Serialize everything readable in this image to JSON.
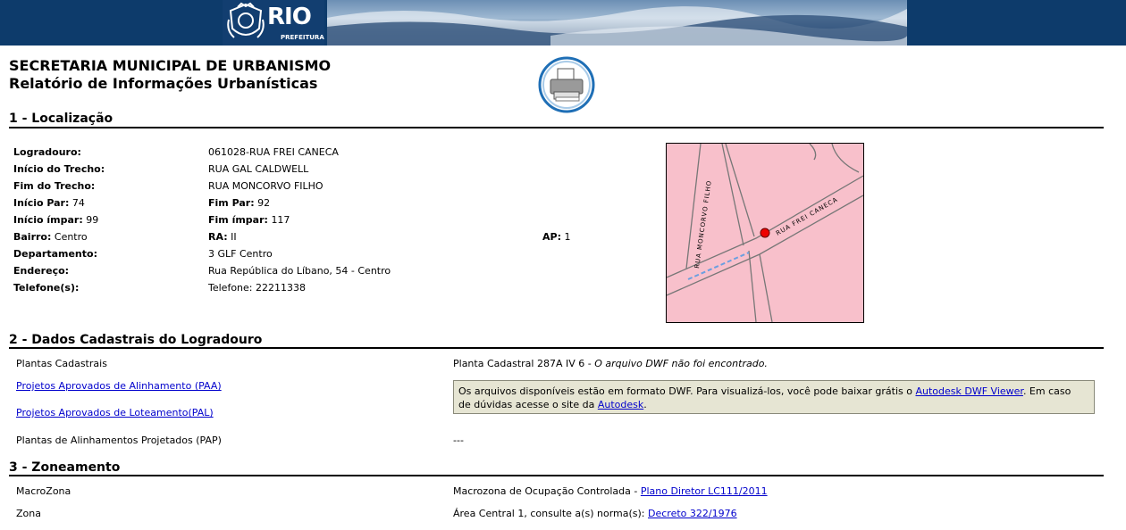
{
  "header": {
    "brand": "RIO",
    "brand_sub": "PREFEITURA"
  },
  "page": {
    "title_line1": "SECRETARIA MUNICIPAL DE URBANISMO",
    "title_line2": "Relatório de Informações Urbanísticas"
  },
  "section1": {
    "title": "1 - Localização",
    "logradouro_label": "Logradouro:",
    "logradouro": "061028-RUA FREI CANECA",
    "inicio_trecho_label": "Início do Trecho:",
    "inicio_trecho": "RUA GAL CALDWELL",
    "fim_trecho_label": "Fim do Trecho:",
    "fim_trecho": "RUA MONCORVO FILHO",
    "inicio_par_label": "Início Par:",
    "inicio_par": "74",
    "fim_par_label": "Fim Par:",
    "fim_par": "92",
    "inicio_impar_label": "Início ímpar:",
    "inicio_impar": "99",
    "fim_impar_label": "Fim ímpar:",
    "fim_impar": "117",
    "bairro_label": "Bairro:",
    "bairro": "Centro",
    "ra_label": "RA:",
    "ra": "II",
    "ap_label": "AP:",
    "ap": "1",
    "departamento_label": "Departamento:",
    "departamento": "3 GLF Centro",
    "endereco_label": "Endereço:",
    "endereco": "Rua República do Líbano, 54 - Centro",
    "telefone_label": "Telefone(s):",
    "telefone": "Telefone: 22211338",
    "map": {
      "street1": "RUA MONCORVO FILHO",
      "street2": "RUA FREI CANECA",
      "bg_color": "#f8c0cb"
    }
  },
  "section2": {
    "title": "2 - Dados Cadastrais do Logradouro",
    "plantas_label": "Plantas Cadastrais",
    "plantas_value": "Planta Cadastral 287A IV 6 -",
    "plantas_value_italic": "O arquivo DWF não foi encontrado.",
    "paa_link": "Projetos Aprovados de Alinhamento (PAA)",
    "pal_link": "Projetos Aprovados de Loteamento(PAL)",
    "note_text1": "Os arquivos disponíveis estão em formato DWF. Para visualizá-los, você pode baixar grátis o",
    "note_link1": "Autodesk DWF Viewer",
    "note_text2": ". Em caso",
    "note_text3": "de dúvidas acesse o site da",
    "note_link2": "Autodesk",
    "note_text4": ".",
    "pap_label": "Plantas de Alinhamentos Projetados (PAP)",
    "pap_value": "---"
  },
  "section3": {
    "title": "3 - Zoneamento",
    "macrozona_label": "MacroZona",
    "macrozona_value": "Macrozona de Ocupação Controlada -",
    "macrozona_link": "Plano Diretor LC111/2011",
    "zona_label": "Zona",
    "zona_value": "Área Central 1, consulte a(s) norma(s):",
    "zona_link": "Decreto 322/1976"
  }
}
